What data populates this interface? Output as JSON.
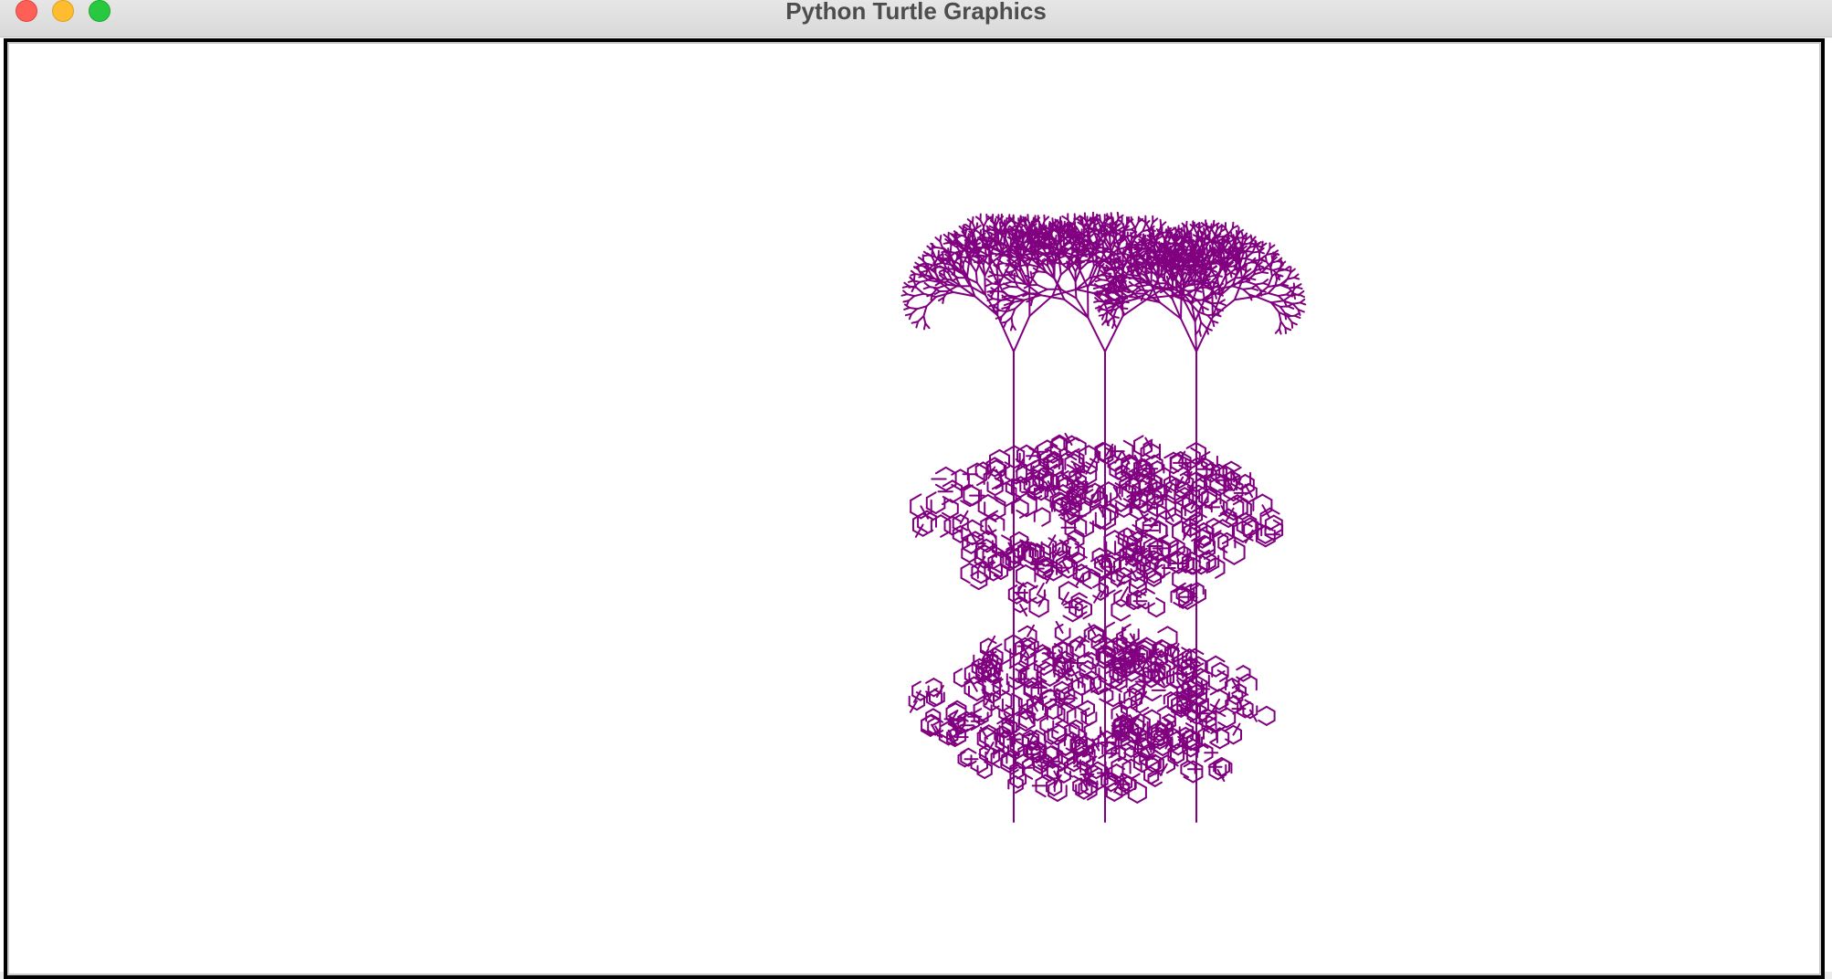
{
  "window": {
    "title": "Python Turtle Graphics",
    "controls": [
      {
        "name": "close-button",
        "icon": "close-icon",
        "color": "#fe5f57"
      },
      {
        "name": "minimize-button",
        "icon": "minimize-icon",
        "color": "#febc2e"
      },
      {
        "name": "zoom-button",
        "icon": "zoom-icon",
        "color": "#28c840"
      }
    ]
  },
  "canvas": {
    "background": "#ffffff",
    "pen_color": "#800080",
    "drawing": "fractal-plant-drawing"
  }
}
